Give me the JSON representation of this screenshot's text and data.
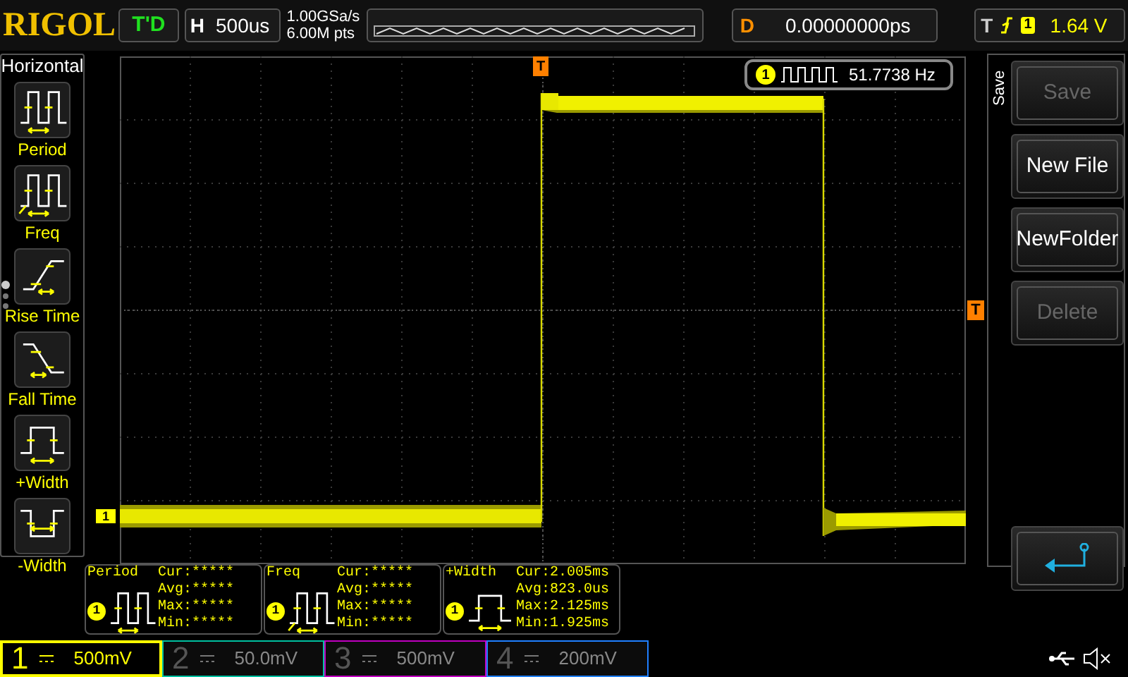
{
  "top_bar": {
    "logo": "RIGOL",
    "run_status": "T'D",
    "horizontal": {
      "label": "H",
      "value": "500us"
    },
    "sample_rate": "1.00GSa/s",
    "memory_depth": "6.00M pts",
    "delay": {
      "label": "D",
      "value": "0.00000000ps"
    },
    "trigger": {
      "label": "T",
      "channel": "1",
      "level_value": "1.64 V"
    }
  },
  "left_menu": {
    "title": "Horizontal",
    "items": [
      {
        "kind": "period",
        "label": "Period"
      },
      {
        "kind": "freq",
        "label": "Freq"
      },
      {
        "kind": "rise",
        "label": "Rise Time"
      },
      {
        "kind": "fall",
        "label": "Fall Time"
      },
      {
        "kind": "pwidth",
        "label": "+Width"
      },
      {
        "kind": "nwidth",
        "label": "-Width"
      }
    ]
  },
  "display": {
    "trigger_marker": "T",
    "trigger_level_marker": "T",
    "channel_marker": "1",
    "counter": {
      "channel": "1",
      "value": "51.7738 Hz"
    }
  },
  "right_menu": {
    "title": "Save",
    "buttons": [
      {
        "kind": "text",
        "label": "Save",
        "disabled": true
      },
      {
        "kind": "text",
        "label": "New File",
        "disabled": false
      },
      {
        "kind": "text",
        "label": "NewFolder",
        "disabled": false
      },
      {
        "kind": "text",
        "label": "Delete",
        "disabled": true
      },
      {
        "kind": "return",
        "disabled": false
      }
    ]
  },
  "measurements": [
    {
      "kind": "period",
      "title": "Period",
      "channel": "1",
      "rows": [
        {
          "label": "Cur:",
          "value": "*****"
        },
        {
          "label": "Avg:",
          "value": "*****"
        },
        {
          "label": "Max:",
          "value": "*****"
        },
        {
          "label": "Min:",
          "value": "*****"
        }
      ]
    },
    {
      "kind": "freq",
      "title": "Freq",
      "channel": "1",
      "rows": [
        {
          "label": "Cur:",
          "value": "*****"
        },
        {
          "label": "Avg:",
          "value": "*****"
        },
        {
          "label": "Max:",
          "value": "*****"
        },
        {
          "label": "Min:",
          "value": "*****"
        }
      ]
    },
    {
      "kind": "pwidth",
      "title": "+Width",
      "channel": "1",
      "rows": [
        {
          "label": "Cur:",
          "value": "2.005ms"
        },
        {
          "label": "Avg:",
          "value": "823.0us"
        },
        {
          "label": "Max:",
          "value": "2.125ms"
        },
        {
          "label": "Min:",
          "value": "1.925ms"
        }
      ]
    }
  ],
  "channels": [
    {
      "number": "1",
      "scale": "500mV",
      "selected": true,
      "color": "#ffff00"
    },
    {
      "number": "2",
      "scale": "50.0mV",
      "selected": false,
      "color": "#00c0a0"
    },
    {
      "number": "3",
      "scale": "500mV",
      "selected": false,
      "color": "#c000c0"
    },
    {
      "number": "4",
      "scale": "200mV",
      "selected": false,
      "color": "#2080ff"
    }
  ]
}
